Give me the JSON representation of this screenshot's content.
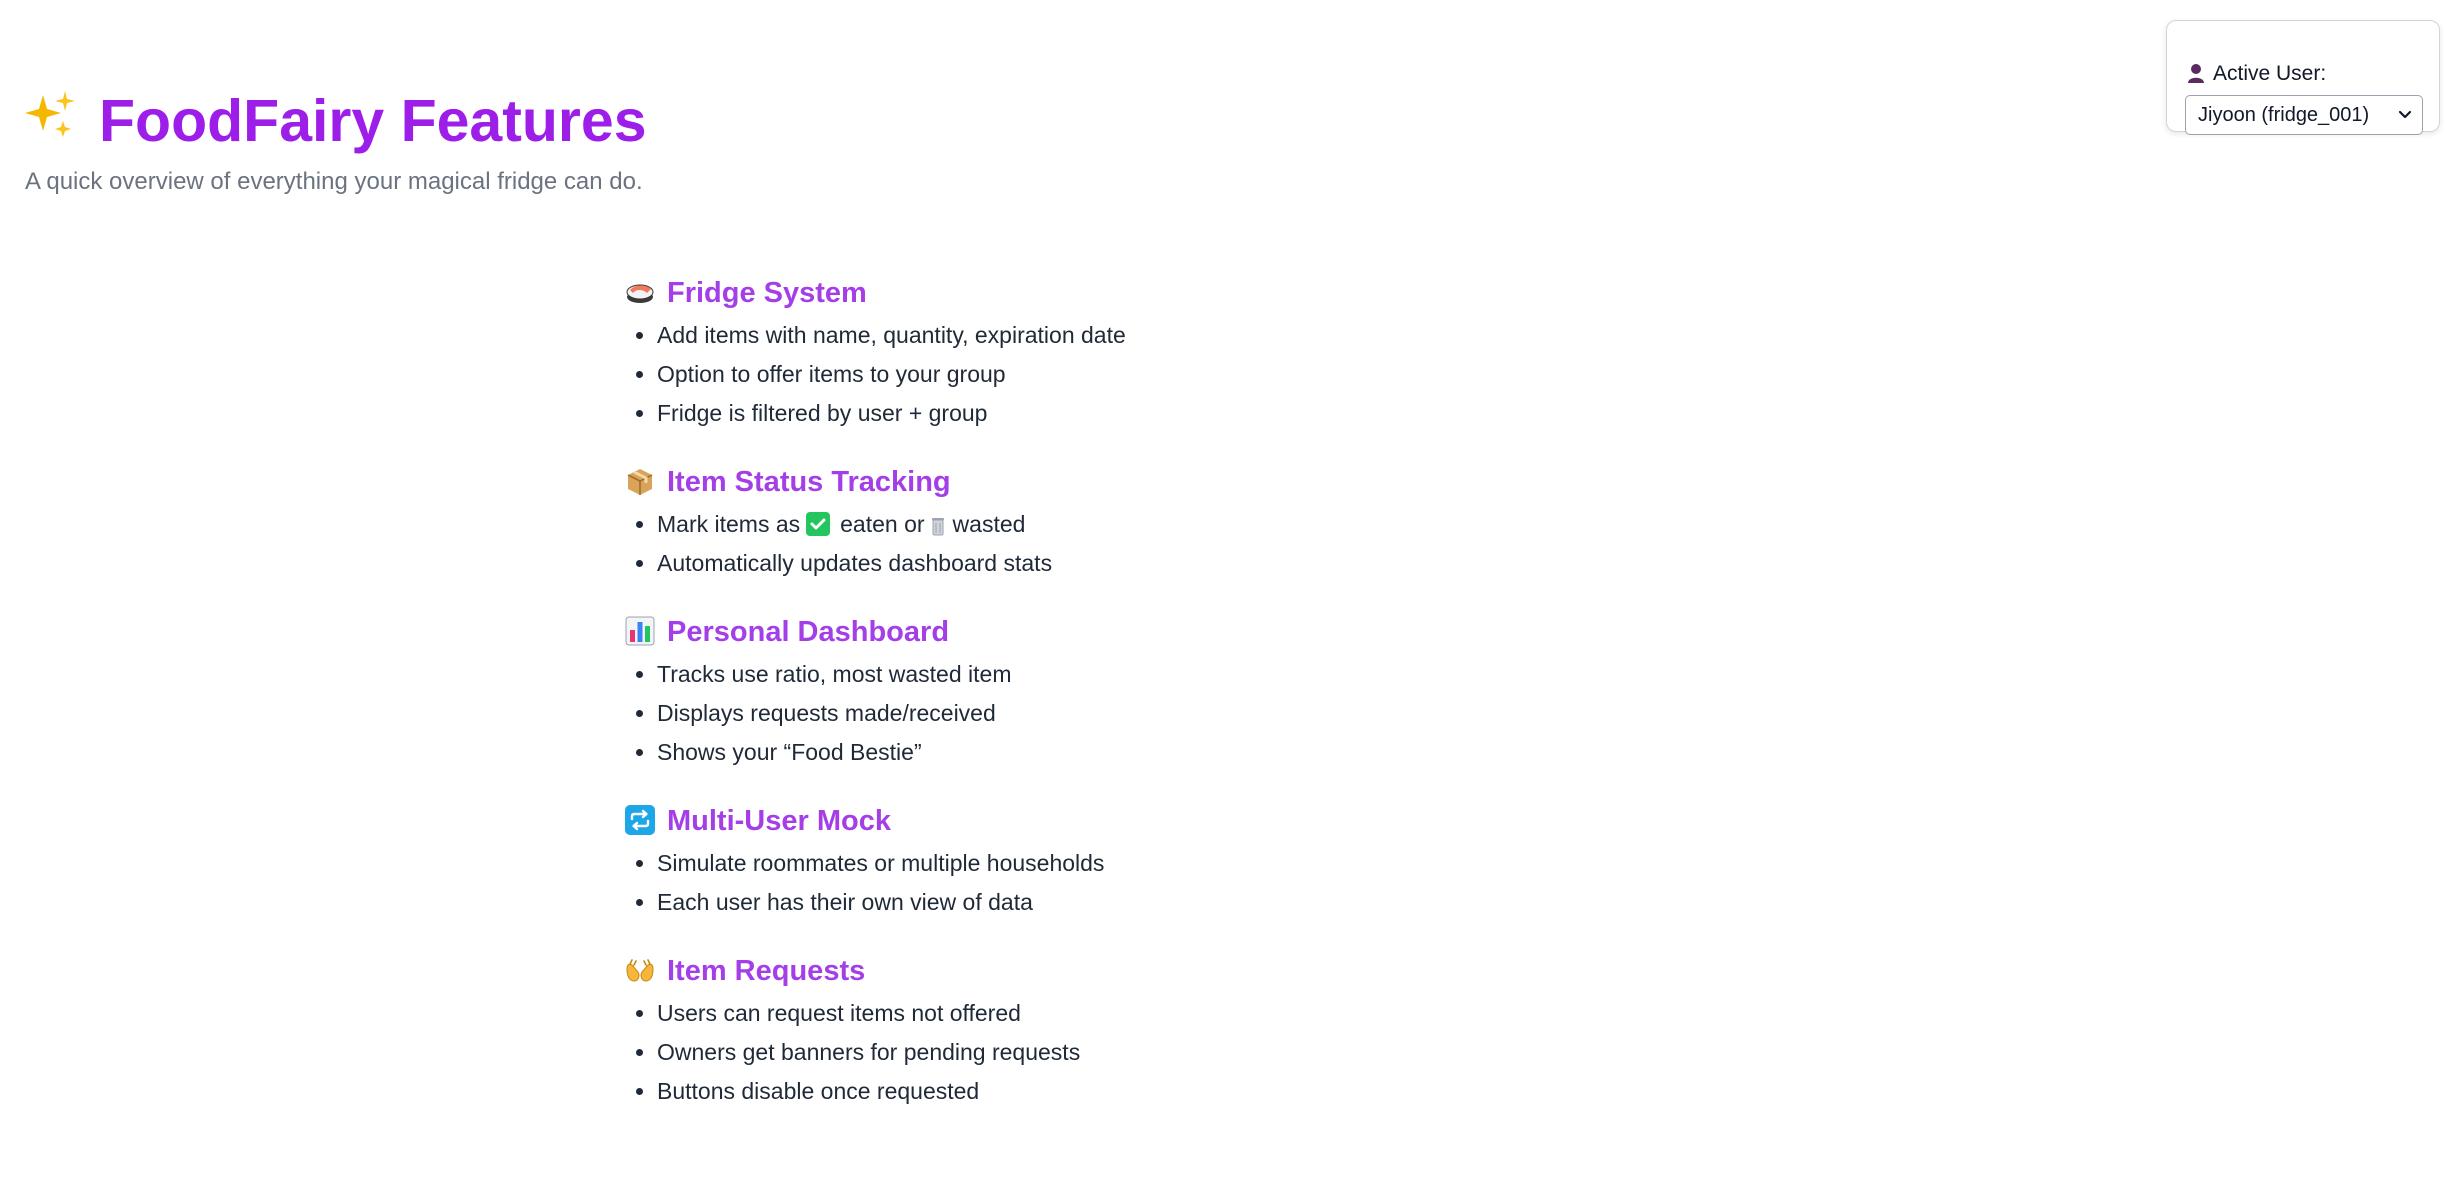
{
  "header": {
    "title": "FoodFairy Features",
    "title_icon": "sparkles-icon",
    "subtitle": "A quick overview of everything your magical fridge can do."
  },
  "user_panel": {
    "label": "Active User:",
    "icon": "person-icon",
    "selected_user": "Jiyoon (fridge_001)"
  },
  "sections": [
    {
      "icon": "sushi-icon",
      "title": "Fridge System",
      "items": [
        "Add items with name, quantity, expiration date",
        "Option to offer items to your group",
        "Fridge is filtered by user + group"
      ]
    },
    {
      "icon": "package-icon",
      "title": "Item Status Tracking",
      "items_status": {
        "prefix": "Mark items as",
        "eaten": "eaten or",
        "wasted": "wasted"
      },
      "items": [
        "Automatically updates dashboard stats"
      ]
    },
    {
      "icon": "bar-chart-icon",
      "title": "Personal Dashboard",
      "items": [
        "Tracks use ratio, most wasted item",
        "Displays requests made/received",
        "Shows your “Food Bestie”"
      ]
    },
    {
      "icon": "repeat-icon",
      "title": "Multi-User Mock",
      "items": [
        "Simulate roommates or multiple households",
        "Each user has their own view of data"
      ]
    },
    {
      "icon": "open-hands-icon",
      "title": "Item Requests",
      "items": [
        "Users can request items not offered",
        "Owners get banners for pending requests",
        "Buttons disable once requested"
      ]
    }
  ],
  "colors": {
    "title": "#9d1ee8",
    "section_title": "#a43fe8",
    "subtitle": "#6b7280",
    "check": "#22c55e"
  }
}
